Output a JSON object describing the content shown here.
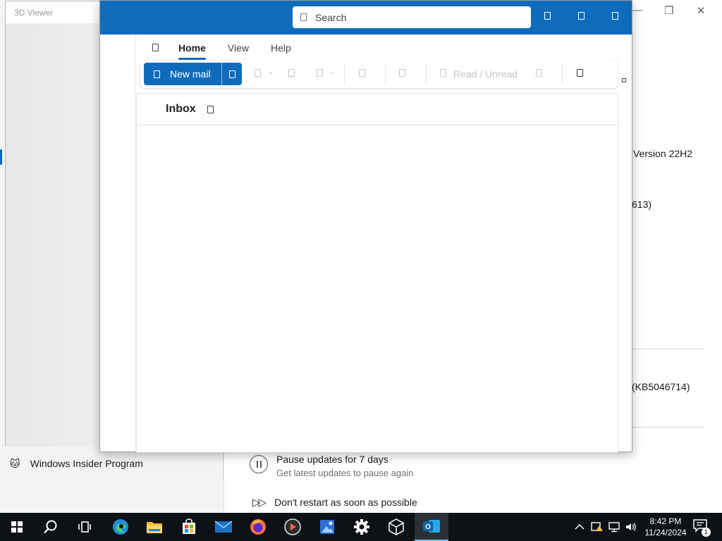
{
  "settings_window": {
    "sidebar_item_label": "Windows Insider Program",
    "version_text": "Version 22H2",
    "build_fragment": "613)",
    "kb_fragment": "(KB5046714)",
    "pause_title": "Pause updates for 7 days",
    "pause_subtitle": "Get latest updates to pause again",
    "restart_title": "Don't restart as soon as possible"
  },
  "viewer_window": {
    "title": "3D Viewer"
  },
  "outlook": {
    "search_placeholder": "Search",
    "tabs": [
      {
        "label": "Home",
        "active": true
      },
      {
        "label": "View",
        "active": false
      },
      {
        "label": "Help",
        "active": false
      }
    ],
    "ribbon": {
      "new_mail_label": "New mail",
      "read_unread_label": "Read / Unread"
    },
    "folder_title": "Inbox",
    "accent_color": "#0f6cbd"
  },
  "taskbar": {
    "apps": [
      "start-icon",
      "search-icon",
      "task-view-icon",
      "edge-icon",
      "file-explorer-icon",
      "store-icon",
      "mail-icon",
      "firefox-icon",
      "media-player-icon",
      "paint-icon",
      "settings-icon",
      "3d-viewer-icon",
      "outlook-icon"
    ],
    "time": "8:42 PM",
    "date": "11/24/2024",
    "notification_count": "1"
  }
}
